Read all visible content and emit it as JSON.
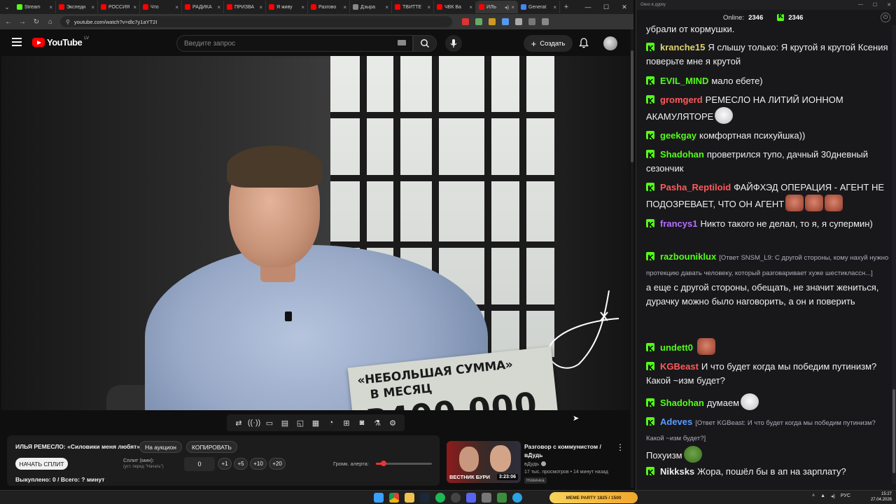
{
  "browser": {
    "tabs": [
      {
        "label": "Stream",
        "color": "#53fc18"
      },
      {
        "label": "Экспеди",
        "color": "#ff0000"
      },
      {
        "label": "РОССИЯ",
        "color": "#ff0000"
      },
      {
        "label": "Что",
        "color": "#ff0000"
      },
      {
        "label": "РАДИКА",
        "color": "#ff0000"
      },
      {
        "label": "ПРИЗВА",
        "color": "#ff0000"
      },
      {
        "label": "Я живу",
        "color": "#ff0000"
      },
      {
        "label": "Разгово",
        "color": "#ff0000"
      },
      {
        "label": "Дзыра",
        "color": "#888888"
      },
      {
        "label": "ТВИТТЕ",
        "color": "#ff0000"
      },
      {
        "label": "ЧВК Ва",
        "color": "#ff0000"
      },
      {
        "label": "ИЛЬ",
        "color": "#ff0000"
      },
      {
        "label": "Generat",
        "color": "#4285f4"
      }
    ],
    "url": "youtube.com/watch?v=dlc7y1aYT2I"
  },
  "youtube": {
    "logo_text": "YouTube",
    "region": "LV",
    "search_placeholder": "Введите запрос",
    "create_label": "Создать"
  },
  "video": {
    "caption_line1": "«НЕБОЛЬШАЯ СУММА»",
    "caption_line2": "В МЕСЯЦ",
    "caption_amount": "₽400 000"
  },
  "auction_panel": {
    "title": "ИЛЬЯ РЕМЕСЛО: «Силовики меня любят»",
    "auction_button": "На аукцион",
    "copy_button": "КОПИРОВАТЬ",
    "start_split_button": "НАЧАТЬ СПЛИТ",
    "split_label": "Сплит (мин):",
    "split_hint": "(уст. перед \"Начать\")",
    "split_value": "0",
    "increments": [
      "+1",
      "+5",
      "+10",
      "+20"
    ],
    "alert_volume_label": "Громк. алерта:",
    "alert_volume_level": 0.14,
    "footer": "Выкуплено: 0 / Всего: ? минут"
  },
  "recommendation": {
    "title": "Разговор с коммунистом / вДудь",
    "channel": "вДудь",
    "meta": "17 тыс. просмотров • 14 минут назад",
    "badge": "Новинка",
    "duration": "3:23:06",
    "thumb_text": "ВЕСТНИК БУРИ"
  },
  "chat": {
    "window_title": "Окно в дурку",
    "online_label": "Online:",
    "online_count": "2346",
    "kick_count": "2346",
    "messages": [
      {
        "user": "",
        "color": "#efeff1",
        "text": "убрали от кормушки."
      },
      {
        "user": "kranche15",
        "color": "#e1d36b",
        "text": "Я слышу только: Я крутой я крутой Ксения поверьте мне я крутой"
      },
      {
        "user": "EVIL_MIND",
        "color": "#53fc18",
        "text": "мало ебете)"
      },
      {
        "user": "gromgerd",
        "color": "#ff5a5a",
        "text": "РЕМЕСЛО НА ЛИТИЙ ИОННОМ АКАМУЛЯТОРЕ"
      },
      {
        "user": "geekgay",
        "color": "#53fc18",
        "text": "комфортная психуйшка))"
      },
      {
        "user": "Shadohan",
        "color": "#53fc18",
        "text": "проветрился тупо, дачный 30дневный сезончик"
      },
      {
        "user": "Pasha_Reptiloid",
        "color": "#ff5a5a",
        "text": "ФАЙФХЭД ОПЕРАЦИЯ - АГЕНТ НЕ ПОДОЗРЕВАЕТ, ЧТО ОН АГЕНТ"
      },
      {
        "user": "francys1",
        "color": "#b66dff",
        "text": "Никто такого не делал, то я, я супермин)"
      },
      {
        "user": "razbouniklux",
        "color": "#53fc18",
        "reply": "[Ответ SNSM_L9: С другой стороны, кому нахуй нужно протекцию давать человеку, который разговаривает хуже шестиклассн...]",
        "text": "а еще с другой стороны, обещать, не значит жениться, дурачку можно было наговорить, а он и поверить"
      },
      {
        "user": "undett0",
        "color": "#53fc18",
        "text": ""
      },
      {
        "user": "KGBeast",
        "color": "#ff5a5a",
        "text": "И что будет когда мы победим путинизм? Какой ~изм будет?"
      },
      {
        "user": "Shadohan",
        "color": "#53fc18",
        "text": "думаем"
      },
      {
        "user": "Adeves",
        "color": "#5b9bff",
        "reply": "[Ответ KGBeast: И что будет когда мы победим путинизм? Какой ~изм будет?]",
        "text": "Похуизм"
      },
      {
        "user": "Nikksks",
        "color": "#efeff1",
        "text": "Жора, пошёл бы в ап на зарплату?"
      }
    ]
  },
  "taskbar": {
    "meme_widget": "MEME PARTY",
    "meme_progress": "1825 / 1500",
    "lang": "РУС",
    "time": "15:27",
    "date": "27.04.2026"
  }
}
